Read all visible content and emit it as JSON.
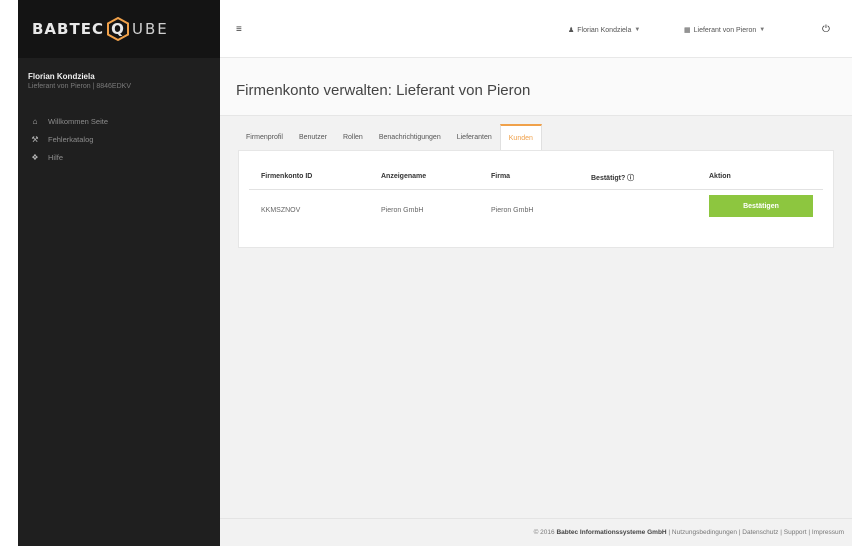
{
  "brand": {
    "logo_left": "BABTEC",
    "logo_cube_letter": "Q",
    "logo_right": "UBE"
  },
  "user": {
    "name": "Florian Kondziela",
    "subtitle": "Lieferant von Pieron | 8846EDKV"
  },
  "nav": [
    {
      "icon": "home-icon",
      "label": "Willkommen Seite"
    },
    {
      "icon": "wrench-icon",
      "label": "Fehlerkatalog"
    },
    {
      "icon": "help-icon",
      "label": "Hilfe"
    }
  ],
  "topbar": {
    "user_label": "Florian Kondziela",
    "company_label": "Lieferant von Pieron"
  },
  "page": {
    "title": "Firmenkonto verwalten: Lieferant von Pieron"
  },
  "tabs": [
    "Firmenprofil",
    "Benutzer",
    "Rollen",
    "Benachrichtigungen",
    "Lieferanten",
    "Kunden"
  ],
  "active_tab": "Kunden",
  "table": {
    "headers": [
      "Firmenkonto ID",
      "Anzeigename",
      "Firma",
      "Bestätigt? ⓘ",
      "Aktion"
    ],
    "rows": [
      {
        "id": "KKMSZNOV",
        "display_name": "Pieron GmbH",
        "company": "Pieron GmbH",
        "confirmed": "",
        "action": "Bestätigen"
      }
    ]
  },
  "footer": {
    "copyright": "© 2016",
    "company": "Babtec Informationssysteme GmbH",
    "links": [
      "Nutzungsbedingungen",
      "Datenschutz",
      "Support",
      "Impressum"
    ]
  },
  "colors": {
    "accent": "#f0a14a",
    "confirm": "#8dc63f",
    "sidebar": "#1f1f1f"
  }
}
